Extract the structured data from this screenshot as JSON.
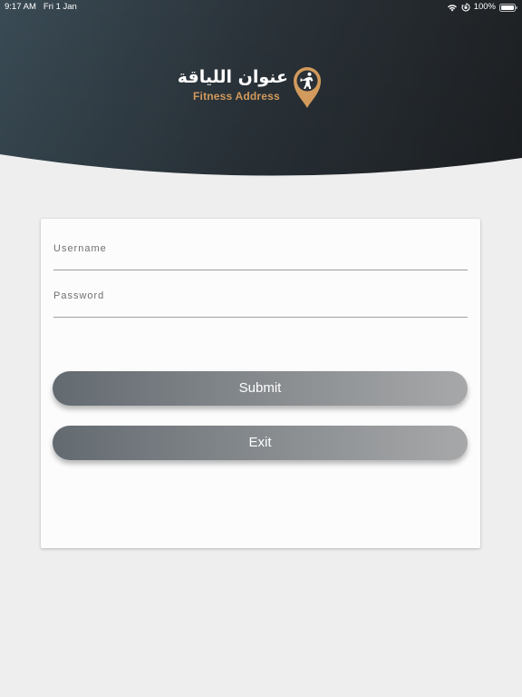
{
  "status_bar": {
    "time": "9:17 AM",
    "date": "Fri 1 Jan",
    "battery": "100%",
    "icons": [
      "wifi-icon",
      "orientation-lock-icon",
      "battery-icon"
    ]
  },
  "brand": {
    "arabic_name": "عنوان اللياقة",
    "english_name": "Fitness Address",
    "icon": "location-pin-icon",
    "accent_color": "#d29a5c",
    "header_color": "#2a3036"
  },
  "login_form": {
    "username": {
      "placeholder": "Username",
      "value": ""
    },
    "password": {
      "placeholder": "Password",
      "value": ""
    },
    "submit_label": "Submit",
    "exit_label": "Exit"
  }
}
